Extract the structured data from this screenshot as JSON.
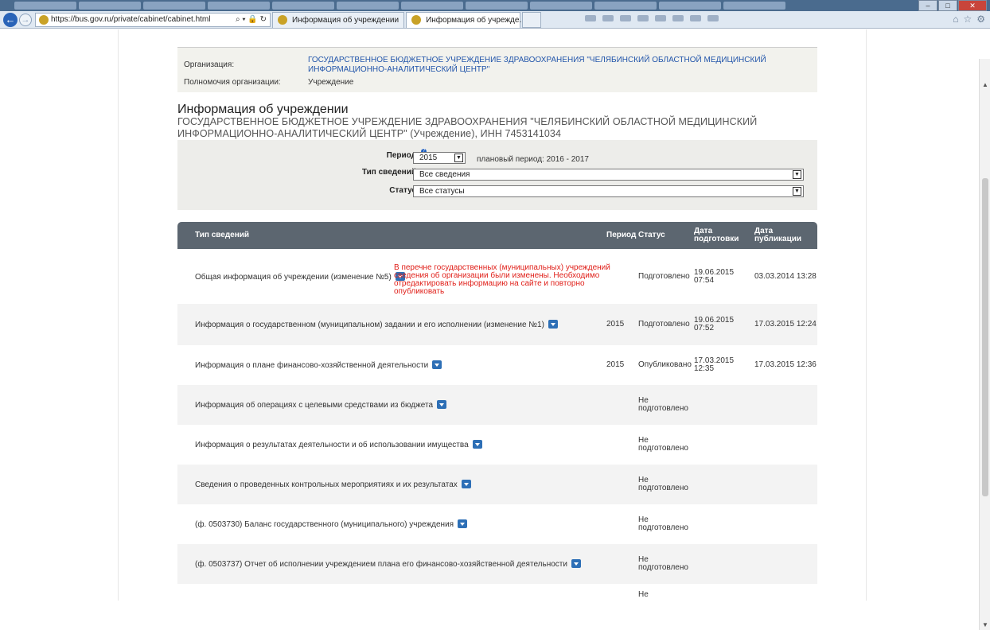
{
  "browser": {
    "url": "https://bus.gov.ru/private/cabinet/cabinet.html",
    "tabs": [
      {
        "label": "Информация об учреждении",
        "active": false
      },
      {
        "label": "Информация об учрежде...",
        "active": true
      }
    ],
    "tab_close": "×"
  },
  "org": {
    "org_label": "Организация:",
    "org_name": "ГОСУДАРСТВЕННОЕ БЮДЖЕТНОЕ УЧРЕЖДЕНИЕ ЗДРАВООХРАНЕНИЯ \"ЧЕЛЯБИНСКИЙ ОБЛАСТНОЙ МЕДИЦИНСКИЙ ИНФОРМАЦИОННО-АНАЛИТИЧЕСКИЙ ЦЕНТР\"",
    "authority_label": "Полномочия организации:",
    "authority_value": "Учреждение"
  },
  "page": {
    "title": "Информация об учреждении",
    "subtitle": "ГОСУДАРСТВЕННОЕ БЮДЖЕТНОЕ УЧРЕЖДЕНИЕ ЗДРАВООХРАНЕНИЯ \"ЧЕЛЯБИНСКИЙ ОБЛАСТНОЙ МЕДИЦИНСКИЙ ИНФОРМАЦИОННО-АНАЛИТИЧЕСКИЙ ЦЕНТР\" (Учреждение), ИНН 7453141034"
  },
  "filters": {
    "period_label": "Период",
    "period_value": "2015",
    "planning_period": "плановый период: 2016 - 2017",
    "type_label": "Тип сведений",
    "type_value": "Все сведения",
    "status_label": "Статус",
    "status_value": "Все статусы",
    "help_icon": "?"
  },
  "table": {
    "headers": {
      "type": "Тип сведений",
      "period": "Период",
      "status": "Статус",
      "prepared": "Дата подготовки",
      "published": "Дата публикации"
    },
    "rows": [
      {
        "name": "Общая информация об учреждении (изменение №5)",
        "note": "В перечне государственных (муниципальных) учреждений сведения об организации были изменены. Необходимо отредактировать информацию на сайте и повторно опубликовать",
        "period": "",
        "status": "Подготовлено",
        "prepared": "19.06.2015 07:54",
        "published": "03.03.2014 13:28"
      },
      {
        "name": "Информация о государственном (муниципальном) задании и его исполнении (изменение №1)",
        "note": "",
        "period": "2015",
        "status": "Подготовлено",
        "prepared": "19.06.2015 07:52",
        "published": "17.03.2015 12:24"
      },
      {
        "name": "Информация о плане финансово-хозяйственной деятельности",
        "note": "",
        "period": "2015",
        "status": "Опубликовано",
        "prepared": "17.03.2015 12:35",
        "published": "17.03.2015 12:36"
      },
      {
        "name": "Информация об операциях с целевыми средствами из бюджета",
        "note": "",
        "period": "",
        "status": "Не подготовлено",
        "prepared": "",
        "published": ""
      },
      {
        "name": "Информация о результатах деятельности и об использовании имущества",
        "note": "",
        "period": "",
        "status": "Не подготовлено",
        "prepared": "",
        "published": ""
      },
      {
        "name": "Сведения о проведенных контрольных мероприятиях и их результатах",
        "note": "",
        "period": "",
        "status": "Не подготовлено",
        "prepared": "",
        "published": ""
      },
      {
        "name": "(ф. 0503730) Баланс государственного (муниципального) учреждения",
        "note": "",
        "period": "",
        "status": "Не подготовлено",
        "prepared": "",
        "published": ""
      },
      {
        "name": "(ф. 0503737) Отчет об исполнении учреждением плана его финансово-хозяйственной деятельности",
        "note": "",
        "period": "",
        "status": "Не подготовлено",
        "prepared": "",
        "published": ""
      },
      {
        "name": "",
        "note": "",
        "period": "",
        "status": "Не",
        "prepared": "",
        "published": ""
      }
    ]
  }
}
